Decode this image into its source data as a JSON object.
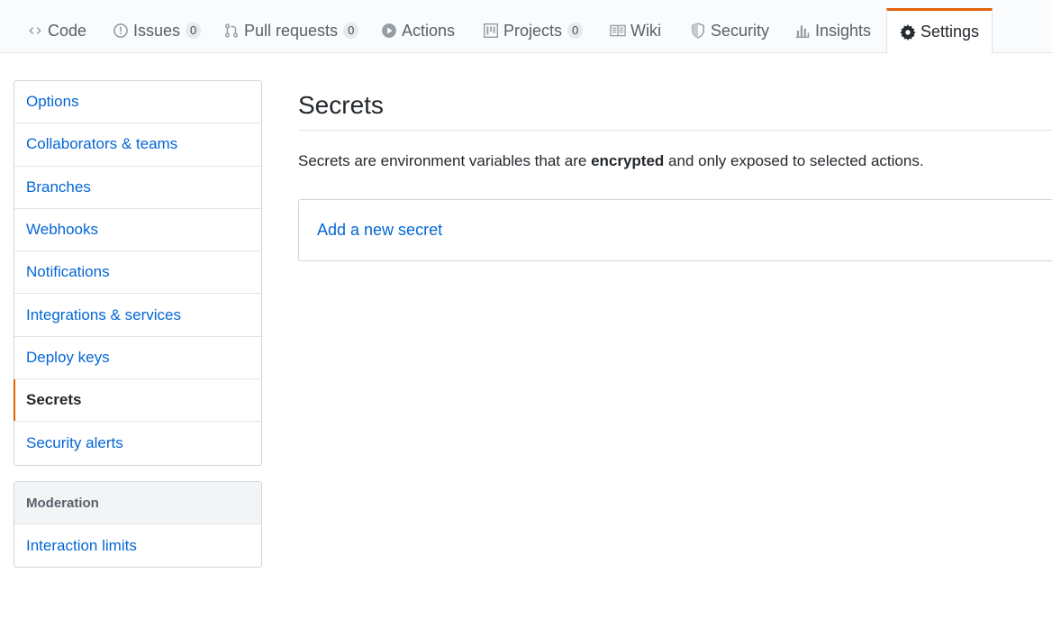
{
  "tabs": [
    {
      "label": "Code",
      "icon": "code-icon"
    },
    {
      "label": "Issues",
      "icon": "issue-icon",
      "count": "0"
    },
    {
      "label": "Pull requests",
      "icon": "pull-request-icon",
      "count": "0"
    },
    {
      "label": "Actions",
      "icon": "play-icon"
    },
    {
      "label": "Projects",
      "icon": "project-icon",
      "count": "0"
    },
    {
      "label": "Wiki",
      "icon": "book-icon"
    },
    {
      "label": "Security",
      "icon": "shield-icon"
    },
    {
      "label": "Insights",
      "icon": "graph-icon"
    },
    {
      "label": "Settings",
      "icon": "gear-icon",
      "selected": true
    }
  ],
  "sidebar": {
    "items": [
      {
        "label": "Options"
      },
      {
        "label": "Collaborators & teams"
      },
      {
        "label": "Branches"
      },
      {
        "label": "Webhooks"
      },
      {
        "label": "Notifications"
      },
      {
        "label": "Integrations & services"
      },
      {
        "label": "Deploy keys"
      },
      {
        "label": "Secrets",
        "selected": true
      },
      {
        "label": "Security alerts"
      }
    ],
    "moderation": {
      "heading": "Moderation",
      "items": [
        {
          "label": "Interaction limits"
        }
      ]
    }
  },
  "main": {
    "title": "Secrets",
    "description": {
      "before": "Secrets are environment variables that are ",
      "bold": "encrypted",
      "after": " and only exposed to selected actions."
    },
    "add_secret_link": "Add a new secret"
  },
  "colors": {
    "accent": "#e36209",
    "link": "#0366d6",
    "text": "#24292e",
    "muted": "#586069"
  }
}
